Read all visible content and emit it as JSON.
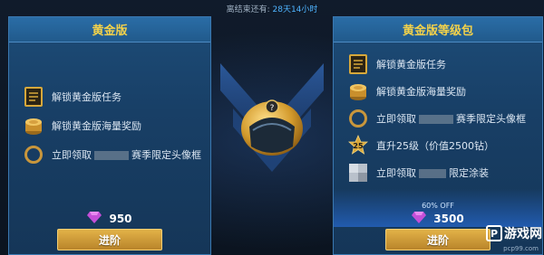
{
  "season_timer": {
    "label": "离结束还有:",
    "value": "28天14小时"
  },
  "free_pass": {
    "title": "黄金版",
    "items": [
      {
        "icon": "task-scroll-icon",
        "label": "解锁黄金版任务"
      },
      {
        "icon": "coin-stack-icon",
        "label": "解锁黄金版海量奖励"
      },
      {
        "icon": "gold-ring-frame-icon",
        "label_before": "立即领取",
        "label_after": "赛季限定头像框"
      }
    ],
    "price": "950",
    "button_label": "进阶"
  },
  "premium_pass": {
    "title": "黄金版等级包",
    "items": [
      {
        "icon": "task-scroll-icon",
        "label": "解锁黄金版任务"
      },
      {
        "icon": "coin-stack-icon",
        "label": "解锁黄金版海量奖励"
      },
      {
        "icon": "gold-ring-frame-icon",
        "label_before": "立即领取",
        "label_after": "赛季限定头像框"
      },
      {
        "icon": "star-badge-icon",
        "badge": "25",
        "label": "直升25级（价值2500钻）"
      },
      {
        "icon": "blurred-skin-icon",
        "label_before": "立即领取",
        "label_after": "限定涂装"
      }
    ],
    "discount": "60% OFF",
    "price": "3500",
    "button_label": "进阶"
  },
  "watermark": {
    "logo": "P",
    "name": "游戏网",
    "url": "pcp99.com"
  },
  "colors": {
    "gold": "#f4d24a",
    "accent_blue": "#4fb4ff",
    "button": "#d6a640",
    "panel": "#1d4c78"
  }
}
